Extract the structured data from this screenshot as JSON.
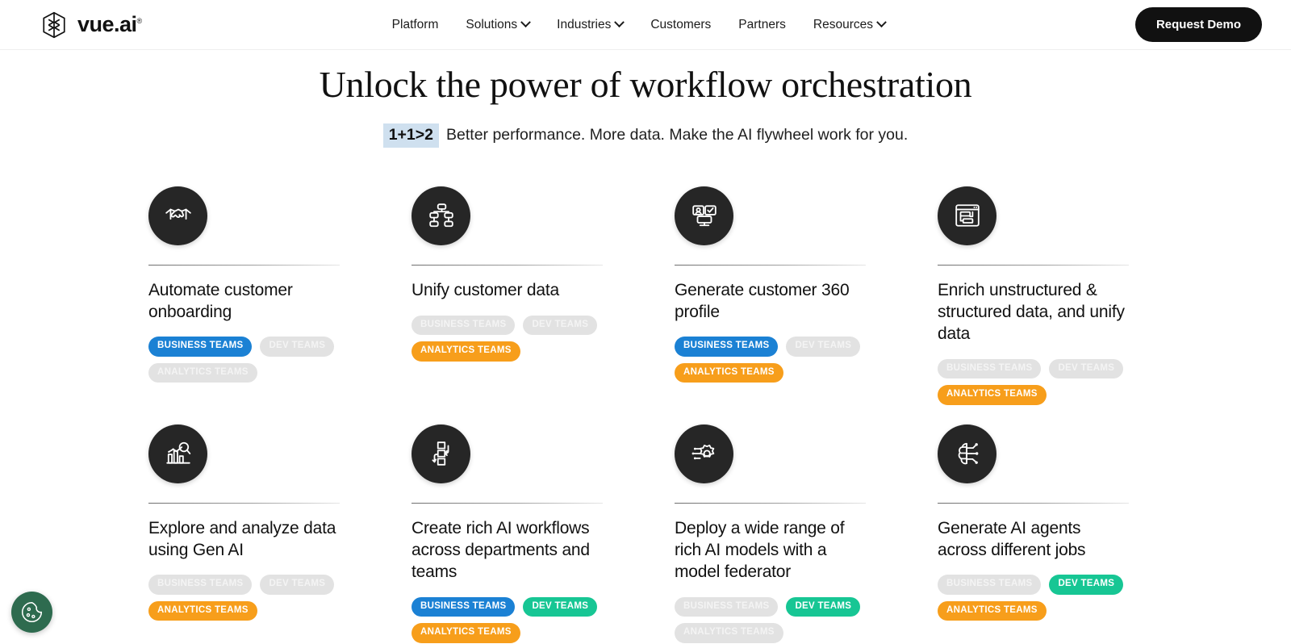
{
  "nav": {
    "logo_text": "vue.ai",
    "logo_registered": "®",
    "links": [
      {
        "label": "Platform",
        "has_caret": false
      },
      {
        "label": "Solutions",
        "has_caret": true
      },
      {
        "label": "Industries",
        "has_caret": true
      },
      {
        "label": "Customers",
        "has_caret": false
      },
      {
        "label": "Partners",
        "has_caret": false
      },
      {
        "label": "Resources",
        "has_caret": true
      }
    ],
    "cta_label": "Request Demo"
  },
  "hero": {
    "title": "Unlock the power of workflow orchestration",
    "badge": "1+1>2",
    "subtitle": "Better performance. More data. Make the AI flywheel work for you.",
    "badge_color": "#cfe0ef"
  },
  "colors": {
    "tag_blue": "#1b81d4",
    "tag_orange": "#f79e1b",
    "tag_green": "#17c694",
    "tag_inactive": "#e2e2e2",
    "icon_circle": "#262626",
    "cookie_green": "#2e6b4f"
  },
  "cards": [
    {
      "icon": "handshake-icon",
      "title": "Automate customer onboarding",
      "tags": [
        {
          "label": "BUSINESS TEAMS",
          "state": "blue"
        },
        {
          "label": "DEV TEAMS",
          "state": "off"
        },
        {
          "label": "ANALYTICS TEAMS",
          "state": "off"
        }
      ]
    },
    {
      "icon": "hierarchy-icon",
      "title": "Unify customer data",
      "tags": [
        {
          "label": "BUSINESS TEAMS",
          "state": "off"
        },
        {
          "label": "DEV TEAMS",
          "state": "off"
        },
        {
          "label": "ANALYTICS TEAMS",
          "state": "orange"
        }
      ]
    },
    {
      "icon": "monitor-profile-icon",
      "title": "Generate customer 360 profile",
      "tags": [
        {
          "label": "BUSINESS TEAMS",
          "state": "blue"
        },
        {
          "label": "DEV TEAMS",
          "state": "off"
        },
        {
          "label": "ANALYTICS TEAMS",
          "state": "orange"
        }
      ]
    },
    {
      "icon": "browser-data-icon",
      "title": "Enrich unstructured & structured data, and unify data",
      "tags": [
        {
          "label": "BUSINESS TEAMS",
          "state": "off"
        },
        {
          "label": "DEV TEAMS",
          "state": "off"
        },
        {
          "label": "ANALYTICS TEAMS",
          "state": "orange"
        }
      ]
    },
    {
      "icon": "chart-magnifier-icon",
      "title": "Explore and analyze data using Gen AI",
      "tags": [
        {
          "label": "BUSINESS TEAMS",
          "state": "off"
        },
        {
          "label": "DEV TEAMS",
          "state": "off"
        },
        {
          "label": "ANALYTICS TEAMS",
          "state": "orange"
        }
      ]
    },
    {
      "icon": "workflow-icon",
      "title": "Create rich AI workflows across departments and teams",
      "tags": [
        {
          "label": "BUSINESS TEAMS",
          "state": "blue"
        },
        {
          "label": "DEV TEAMS",
          "state": "green"
        },
        {
          "label": "ANALYTICS TEAMS",
          "state": "orange"
        }
      ]
    },
    {
      "icon": "tech-gear-icon",
      "title": "Deploy a wide range of rich AI models with a model federator",
      "tags": [
        {
          "label": "BUSINESS TEAMS",
          "state": "off"
        },
        {
          "label": "DEV TEAMS",
          "state": "green"
        },
        {
          "label": "ANALYTICS TEAMS",
          "state": "off"
        }
      ]
    },
    {
      "icon": "ai-brain-circuit-icon",
      "title": "Generate AI agents across different jobs",
      "tags": [
        {
          "label": "BUSINESS TEAMS",
          "state": "off"
        },
        {
          "label": "DEV TEAMS",
          "state": "green"
        },
        {
          "label": "ANALYTICS TEAMS",
          "state": "orange"
        }
      ]
    }
  ],
  "cookie": {
    "icon": "cookie-icon"
  }
}
